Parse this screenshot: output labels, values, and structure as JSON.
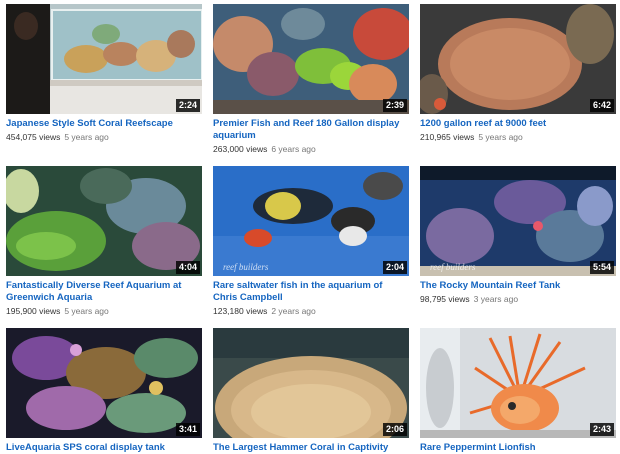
{
  "videos": [
    {
      "title": "Japanese Style Soft Coral Reefscape",
      "views": "454,075 views",
      "age": "5 years ago",
      "duration": "2:24",
      "watermark": ""
    },
    {
      "title": "Premier Fish and Reef 180 Gallon display aquarium",
      "views": "263,000 views",
      "age": "6 years ago",
      "duration": "2:39",
      "watermark": ""
    },
    {
      "title": "1200 gallon reef at 9000 feet",
      "views": "210,965 views",
      "age": "5 years ago",
      "duration": "6:42",
      "watermark": ""
    },
    {
      "title": "Fantastically Diverse Reef Aquarium at Greenwich Aquaria",
      "views": "195,900 views",
      "age": "5 years ago",
      "duration": "4:04",
      "watermark": ""
    },
    {
      "title": "Rare saltwater fish in the aquarium of Chris Campbell",
      "views": "123,180 views",
      "age": "2 years ago",
      "duration": "2:04",
      "watermark": "reef builders"
    },
    {
      "title": "The Rocky Mountain Reef Tank",
      "views": "98,795 views",
      "age": "3 years ago",
      "duration": "5:54",
      "watermark": "reef builders"
    },
    {
      "title": "LiveAquaria SPS coral display tank",
      "views": "",
      "age": "",
      "duration": "3:41",
      "watermark": ""
    },
    {
      "title": "The Largest Hammer Coral in Captivity",
      "views": "",
      "age": "",
      "duration": "2:06",
      "watermark": ""
    },
    {
      "title": "Rare Peppermint Lionfish",
      "views": "",
      "age": "",
      "duration": "2:43",
      "watermark": ""
    }
  ]
}
